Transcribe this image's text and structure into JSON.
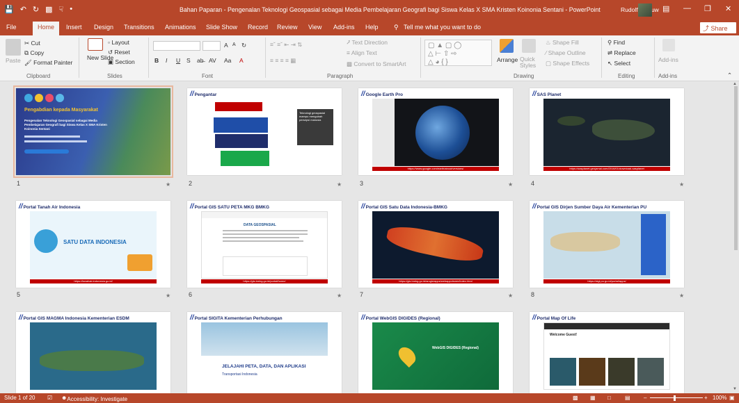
{
  "titlebar": {
    "title": "Bahan Paparan - Pengenalan Teknologi Geospasial sebagai Media Pembelajaran Geografi bagi Siswa Kelas X SMA Kristen Koinonia Sentani  -  PowerPoint",
    "user": "Rudolf Azrauw",
    "qat": [
      "save-icon",
      "undo-icon",
      "redo-icon",
      "present-icon",
      "touch-icon",
      "customize-icon"
    ]
  },
  "tabs": [
    "File",
    "Home",
    "Insert",
    "Design",
    "Transitions",
    "Animations",
    "Slide Show",
    "Record",
    "Review",
    "View",
    "Add-ins",
    "Help"
  ],
  "active_tab": "Home",
  "tell_me": "Tell me what you want to do",
  "share": "Share",
  "ribbon": {
    "clipboard": {
      "paste": "Paste",
      "cut": "Cut",
      "copy": "Copy",
      "format_painter": "Format Painter",
      "label": "Clipboard"
    },
    "slides": {
      "new_slide": "New Slide",
      "layout": "Layout",
      "reset": "Reset",
      "section": "Section",
      "label": "Slides"
    },
    "font": {
      "label": "Font",
      "bold": "B",
      "italic": "I",
      "underline": "U",
      "strike": "S",
      "grow": "A",
      "shrink": "A",
      "case": "Aa"
    },
    "paragraph": {
      "text_direction": "Text Direction",
      "align_text": "Align Text",
      "smartart": "Convert to SmartArt",
      "label": "Paragraph"
    },
    "drawing": {
      "arrange": "Arrange",
      "quick_styles": "Quick Styles",
      "shape_fill": "Shape Fill",
      "shape_outline": "Shape Outline",
      "shape_effects": "Shape Effects",
      "label": "Drawing"
    },
    "editing": {
      "find": "Find",
      "replace": "Replace",
      "select": "Select",
      "label": "Editing"
    },
    "addins": {
      "addins": "Add-ins",
      "label": "Add-ins"
    }
  },
  "status": {
    "slide": "Slide 1 of 20",
    "accessibility": "Accessibility: Investigate",
    "zoom": "100%"
  },
  "slides": [
    {
      "num": "1",
      "title": "",
      "lines": [
        "Pengabdian kepada Masyarakat",
        "Pengenalan Teknologi Geospasial sebagai Media Pembelajaran Geografi bagi Siswa Kelas X SMA Kristen Koinonia Sentani"
      ]
    },
    {
      "num": "2",
      "title": "Pengantar",
      "lines": [
        "Teknologi geospasial mampu mengubah persepsi manusia"
      ]
    },
    {
      "num": "3",
      "title": "Google Earth Pro",
      "link": "https://www.google.com/earth/about/versions/"
    },
    {
      "num": "4",
      "title": "SAS Planet",
      "link": "https://sasplanet.geojamal.com/2016/01/download-sasplanet"
    },
    {
      "num": "5",
      "title": "Portal Tanah Air Indonesia",
      "link": "https://tanahair.indonesia.go.id/",
      "heading": "SATU DATA INDONESIA"
    },
    {
      "num": "6",
      "title": "Portal GIS SATU PETA MKG BMKG",
      "link": "https://gis.bmkg.go.id/portal/home/",
      "heading": "DATA GEOSPASIAL"
    },
    {
      "num": "7",
      "title": "Portal GIS Satu Data Indonesia-BMKG",
      "link": "https://gis.bmkg.go.id/arcgis/apps/webappviewer/index.html"
    },
    {
      "num": "8",
      "title": "Portal GIS Dirjen Sumber Daya Air Kementerian PU",
      "link": "https://sigi.pu.go.id/portal/apps/"
    },
    {
      "num": "",
      "title": "Portal GIS MAGMA Indonesia Kementerian ESDM",
      "link": ""
    },
    {
      "num": "",
      "title": "Portal SIGITA Kementerian Perhubungan",
      "link": "",
      "heading": "JELAJAHI PETA, DATA, DAN APLIKASI",
      "sub": "Transportasi Indonesia"
    },
    {
      "num": "",
      "title": "Portal WebGIS DIGIDES (Regional)",
      "link": "",
      "heading": "WebGIS DIGIDES (Regional)"
    },
    {
      "num": "",
      "title": "Portal Map Of Life",
      "link": "",
      "heading": "Welcome Guest!"
    }
  ],
  "colors": {
    "accent": "#b7472a",
    "ribbon": "#f3f3f3",
    "pane": "#e6e6e6",
    "slide_title": "#1f2d6b",
    "link_bar": "#c00000"
  }
}
